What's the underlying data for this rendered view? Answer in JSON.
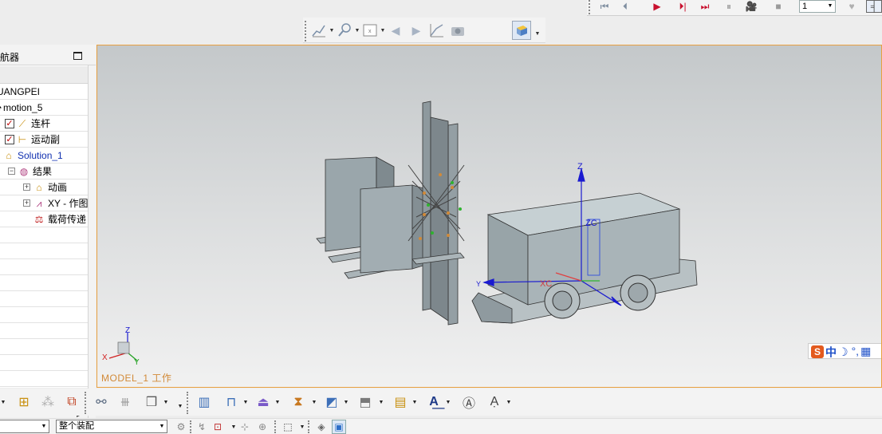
{
  "animation_toolbar": {
    "buttons": [
      "rewind-to-start",
      "step-back",
      "play",
      "step-forward",
      "fast-forward",
      "pause",
      "camera",
      "stop"
    ],
    "frame_value": "1"
  },
  "navigator": {
    "title": "导航器",
    "root": "UANGPEI",
    "motion": "motion_5",
    "links": "连杆",
    "joints": "运动副",
    "solution": "Solution_1",
    "results": "结果",
    "animation": "动画",
    "xy_graph": "XY - 作图",
    "load_transfer": "载荷传递"
  },
  "viewport": {
    "label": "MODEL_1 工作",
    "axes": {
      "z": "Z",
      "x": "X",
      "y": "Y",
      "zc": "ZC",
      "xc": "XC"
    },
    "ime": {
      "s": "S",
      "zh": "中"
    }
  },
  "bottom_toolbar": {
    "selection_filter": "",
    "scope": "整个装配"
  },
  "colors": {
    "viewport_border": "#e8a040",
    "model_fill": "#9aa6ab",
    "axis_blue": "#1a1ad0",
    "label_orange": "#d28a38"
  }
}
